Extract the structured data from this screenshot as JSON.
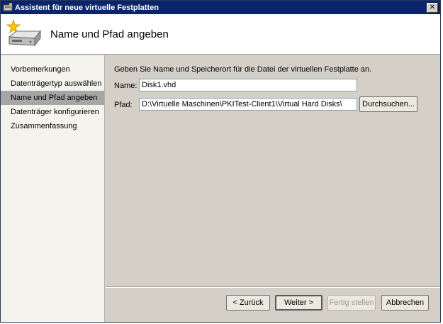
{
  "window": {
    "title": "Assistent für neue virtuelle Festplatten",
    "close_symbol": "✕"
  },
  "header": {
    "title": "Name und Pfad angeben"
  },
  "nav": {
    "items": [
      {
        "label": "Vorbemerkungen",
        "active": false
      },
      {
        "label": "Datenträgertyp auswählen",
        "active": false
      },
      {
        "label": "Name und Pfad angeben",
        "active": true
      },
      {
        "label": "Datenträger konfigurieren",
        "active": false
      },
      {
        "label": "Zusammenfassung",
        "active": false
      }
    ]
  },
  "main": {
    "instruction": "Geben Sie Name und Speicherort für die Datei der virtuellen Festplatte an.",
    "name": {
      "label": "Name:",
      "value": "Disk1.vhd"
    },
    "path": {
      "label": "Pfad:",
      "value": "D:\\Virtuelle Maschinen\\PKITest-Client1\\Virtual Hard Disks\\"
    },
    "browse_label": "Durchsuchen..."
  },
  "footer": {
    "back_label": "< Zurück",
    "next_label": "Weiter >",
    "finish_label": "Fertig stellen",
    "cancel_label": "Abbrechen"
  },
  "colors": {
    "title_bar": "#0a246a",
    "nav_active": "#a6a6a6",
    "dialog_bg": "#d4d0c8"
  }
}
